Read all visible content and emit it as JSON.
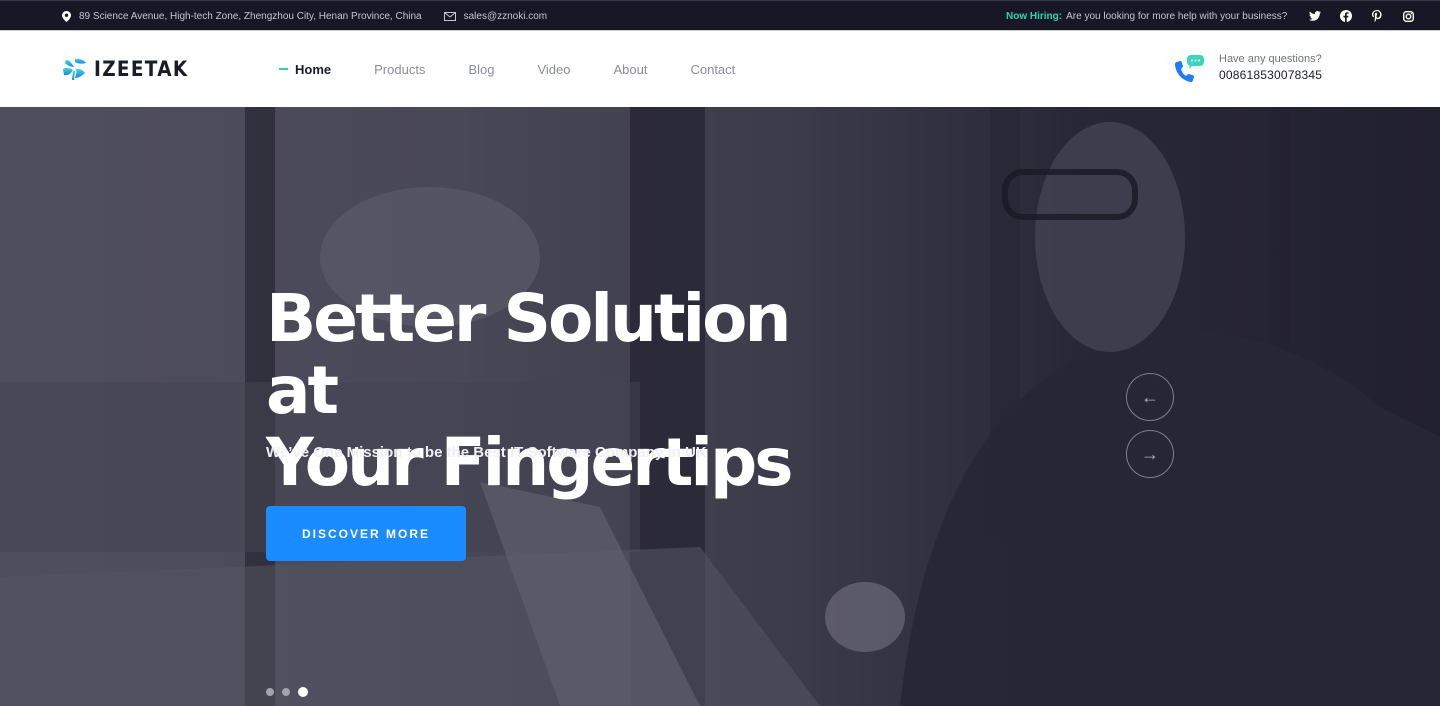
{
  "topbar": {
    "address": "89 Science Avenue, High-tech Zone, Zhengzhou City, Henan Province, China",
    "email": "sales@zznoki.com",
    "hiring_label": "Now Hiring:",
    "hiring_text": "Are you looking for more help with your business?",
    "socials": [
      "twitter-icon",
      "facebook-icon",
      "pinterest-icon",
      "instagram-icon"
    ]
  },
  "header": {
    "logo_text": "IZEETAK",
    "nav": [
      {
        "label": "Home",
        "active": true
      },
      {
        "label": "Products",
        "active": false
      },
      {
        "label": "Blog",
        "active": false
      },
      {
        "label": "Video",
        "active": false
      },
      {
        "label": "About",
        "active": false
      },
      {
        "label": "Contact",
        "active": false
      }
    ],
    "contact_label": "Have any questions?",
    "contact_phone": "008618530078345"
  },
  "hero": {
    "title_line1": "Better Solution at",
    "title_line2": "Your Fingertips",
    "subtitle": "We’ve One Mission to be the Best IT Software Company in UK",
    "cta_label": "DISCOVER MORE",
    "prev_arrow": "←",
    "next_arrow": "→",
    "slides_total": 3,
    "active_slide": 3
  },
  "colors": {
    "accent": "#2ad4b4",
    "primary_button": "#1b8cff",
    "topbar_bg": "#181726",
    "heading_dark": "#1a1c2b"
  }
}
